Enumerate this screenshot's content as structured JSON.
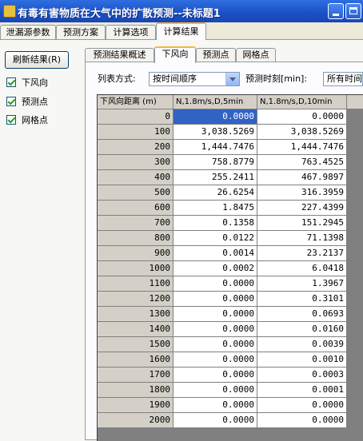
{
  "window": {
    "title": "有毒有害物质在大气中的扩散预测--未标题1"
  },
  "top_tabs": [
    "泄漏源参数",
    "预测方案",
    "计算选项",
    "计算结果"
  ],
  "left": {
    "refresh_label": "刷新结果(R)",
    "checkboxes": [
      {
        "label": "下风向",
        "checked": true
      },
      {
        "label": "预测点",
        "checked": true
      },
      {
        "label": "网格点",
        "checked": true
      }
    ]
  },
  "sub_tabs": [
    "预测结果概述",
    "下风向",
    "预测点",
    "网格点"
  ],
  "options": {
    "list_mode_label": "列表方式:",
    "list_mode_value": "按时间顺序",
    "time_label": "预测时刻[min]:",
    "time_value": "所有时间"
  },
  "table": {
    "headers": [
      "下风向距离 (m)",
      "N,1.8m/s,D,5min",
      "N,1.8m/s,D,10min"
    ],
    "rows": [
      [
        "0",
        "0.0000",
        "0.0000"
      ],
      [
        "100",
        "3,038.5269",
        "3,038.5269"
      ],
      [
        "200",
        "1,444.7476",
        "1,444.7476"
      ],
      [
        "300",
        "758.8779",
        "763.4525"
      ],
      [
        "400",
        "255.2411",
        "467.9897"
      ],
      [
        "500",
        "26.6254",
        "316.3959"
      ],
      [
        "600",
        "1.8475",
        "227.4399"
      ],
      [
        "700",
        "0.1358",
        "151.2945"
      ],
      [
        "800",
        "0.0122",
        "71.1398"
      ],
      [
        "900",
        "0.0014",
        "23.2137"
      ],
      [
        "1000",
        "0.0002",
        "6.0418"
      ],
      [
        "1100",
        "0.0000",
        "1.3967"
      ],
      [
        "1200",
        "0.0000",
        "0.3101"
      ],
      [
        "1300",
        "0.0000",
        "0.0693"
      ],
      [
        "1400",
        "0.0000",
        "0.0160"
      ],
      [
        "1500",
        "0.0000",
        "0.0039"
      ],
      [
        "1600",
        "0.0000",
        "0.0010"
      ],
      [
        "1700",
        "0.0000",
        "0.0003"
      ],
      [
        "1800",
        "0.0000",
        "0.0001"
      ],
      [
        "1900",
        "0.0000",
        "0.0000"
      ],
      [
        "2000",
        "0.0000",
        "0.0000"
      ]
    ]
  }
}
